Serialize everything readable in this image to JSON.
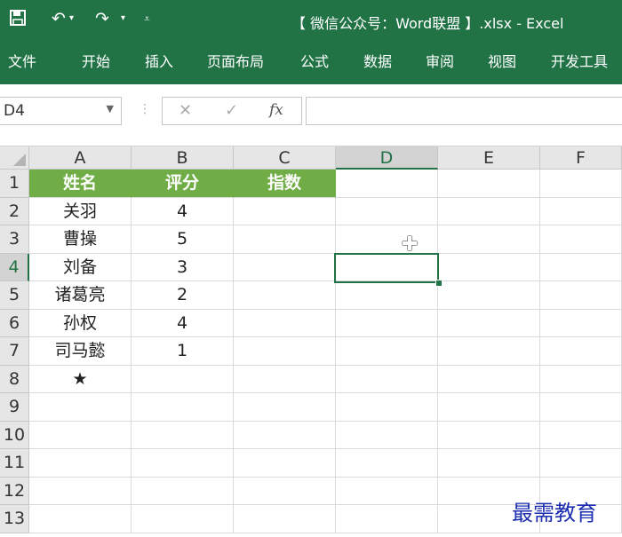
{
  "window": {
    "title": "【 微信公众号：Word联盟 】.xlsx - Excel"
  },
  "qat": {
    "save_icon": "save-icon",
    "undo_icon": "undo-icon",
    "redo_icon": "redo-icon",
    "customize_icon": "customize-qat-icon"
  },
  "ribbon": {
    "tabs": [
      "文件",
      "开始",
      "插入",
      "页面布局",
      "公式",
      "数据",
      "审阅",
      "视图",
      "开发工具"
    ]
  },
  "formula_bar": {
    "name_box": "D4",
    "fx": "fx",
    "cancel": "✕",
    "enter": "✓",
    "value": ""
  },
  "sheet": {
    "columns": [
      "A",
      "B",
      "C",
      "D",
      "E",
      "F"
    ],
    "rows": [
      "1",
      "2",
      "3",
      "4",
      "5",
      "6",
      "7",
      "8",
      "9",
      "10",
      "11",
      "12",
      "13"
    ],
    "header_row": [
      "姓名",
      "评分",
      "指数"
    ],
    "data": [
      [
        "关羽",
        "4"
      ],
      [
        "曹操",
        "5"
      ],
      [
        "刘备",
        "3"
      ],
      [
        "诸葛亮",
        "2"
      ],
      [
        "孙权",
        "4"
      ],
      [
        "司马懿",
        "1"
      ],
      [
        "★",
        ""
      ]
    ],
    "selected_cell": "D4",
    "header_fill": "#70ad47",
    "accent": "#217346"
  },
  "watermark": "最需教育"
}
